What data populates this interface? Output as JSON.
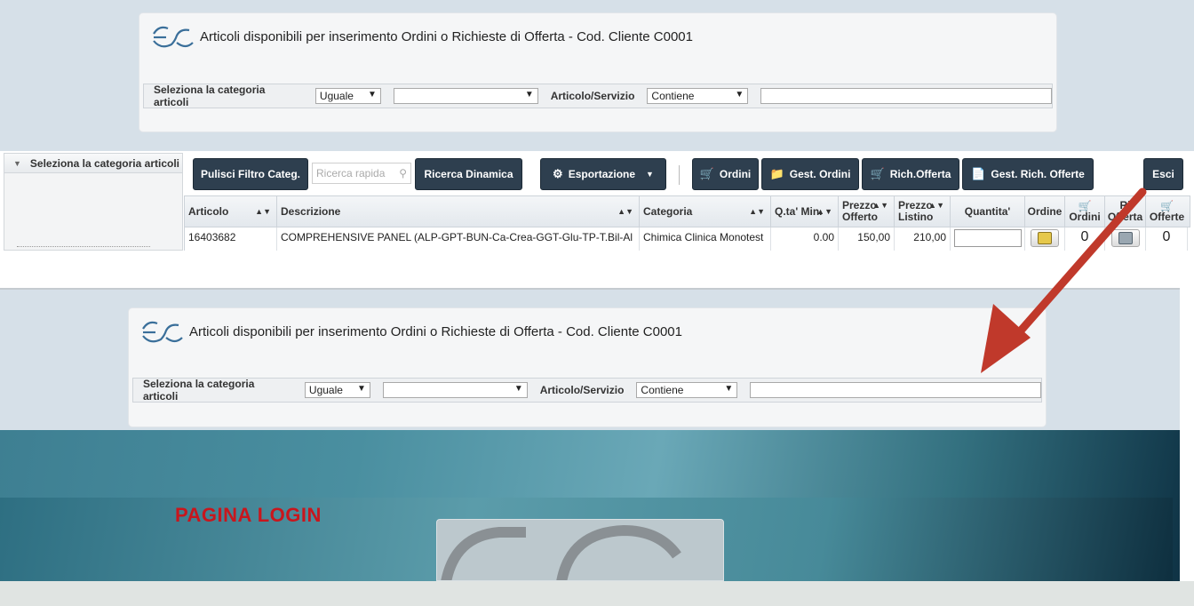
{
  "panel": {
    "title": "Articoli disponibili per inserimento Ordini o Richieste di Offerta - Cod. Cliente C0001",
    "filter": {
      "category_label": "Seleziona la categoria articoli",
      "operator_value": "Uguale",
      "category_value": "",
      "article_label": "Articolo/Servizio",
      "match_value": "Contiene",
      "search_value": ""
    }
  },
  "sidebar": {
    "header": "Seleziona la categoria articoli"
  },
  "toolbar": {
    "clear_filter": "Pulisci Filtro Categ.",
    "quick_search_placeholder": "Ricerca rapida",
    "dynamic_search": "Ricerca Dinamica",
    "export": "Esportazione",
    "orders": "Ordini",
    "manage_orders": "Gest. Ordini",
    "request_offer": "Rich.Offerta",
    "manage_offers": "Gest. Rich. Offerte",
    "exit": "Esci"
  },
  "grid": {
    "columns": {
      "articolo": "Articolo",
      "descrizione": "Descrizione",
      "categoria": "Categoria",
      "qta_min": "Q.ta' Min.",
      "prezzo_offerto_1": "Prezzo",
      "prezzo_offerto_2": "Offerto",
      "prezzo_listino_1": "Prezzo",
      "prezzo_listino_2": "Listino",
      "quantita": "Quantita'",
      "ordine": "Ordine",
      "ordini": "Ordini",
      "rich_offerta_1": "Ri",
      "rich_offerta_2": "Offerta",
      "offerte": "Offerte"
    },
    "rows": [
      {
        "articolo": "16403682",
        "descrizione": "COMPREHENSIVE PANEL (ALP-GPT-BUN-Ca-Crea-GGT-Glu-TP-T.Bil-Al",
        "categoria": "Chimica Clinica Monotest",
        "qta_min": "0.00",
        "prezzo_offerto": "150,00",
        "prezzo_listino": "210,00",
        "quantita": "",
        "ordini": "0",
        "offerte": "0"
      }
    ]
  },
  "login": {
    "title": "PAGINA LOGIN"
  },
  "colors": {
    "toolbar_button": "#2e3f4f",
    "annotation_arrow": "#c0392b",
    "login_title": "#c8161d"
  }
}
